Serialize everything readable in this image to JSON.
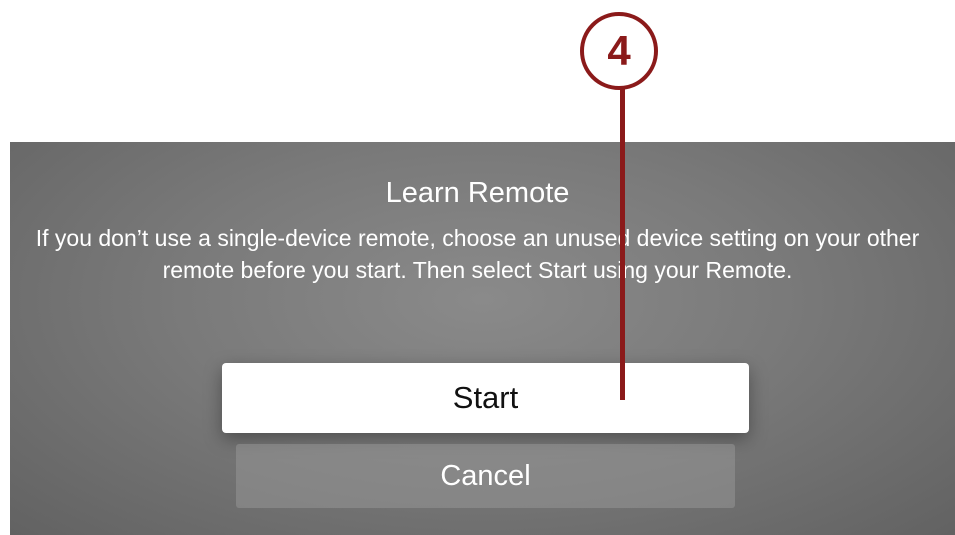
{
  "dialog": {
    "title": "Learn Remote",
    "message": "If you don’t use a single-device remote, choose an unused device setting on your other remote before you start. Then select Start using your Remote.",
    "start_label": "Start",
    "cancel_label": "Cancel"
  },
  "callout": {
    "number": "4",
    "color": "#8b1a1a"
  }
}
